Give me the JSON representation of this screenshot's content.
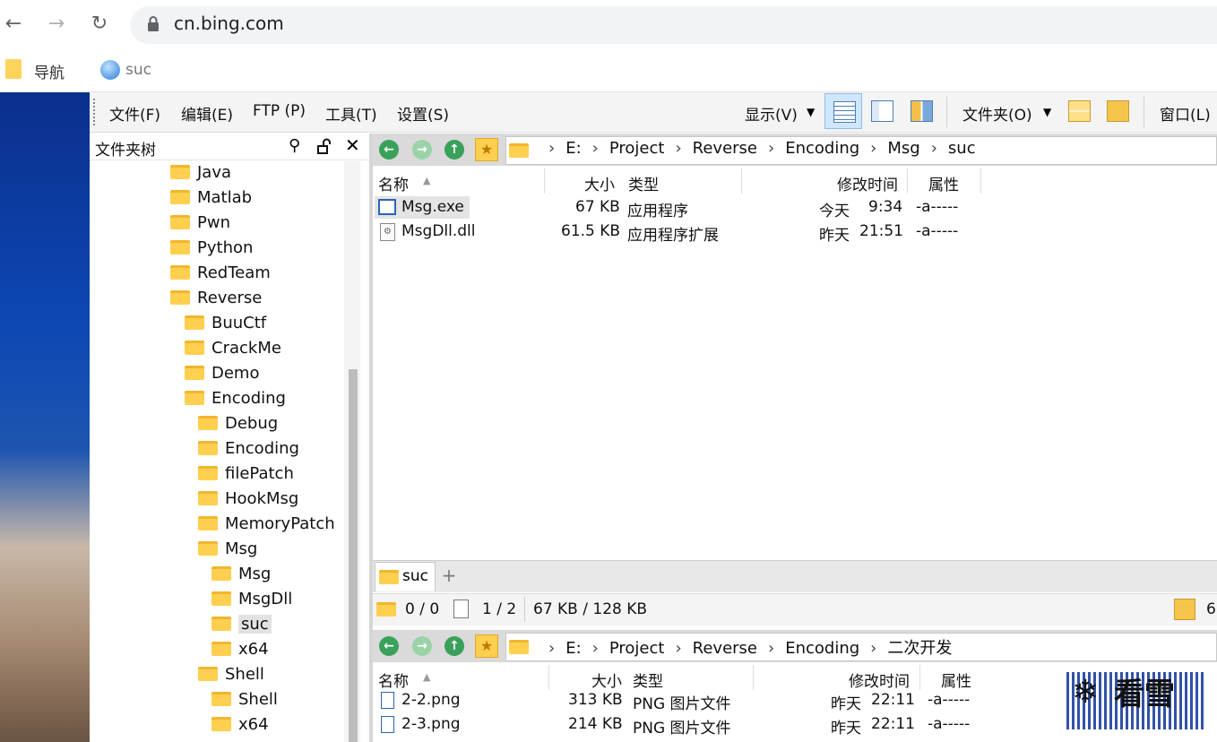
{
  "browser": {
    "url": "cn.bing.com",
    "bookmark_label": "导航",
    "back": "←",
    "forward": "→",
    "reload": "↻"
  },
  "app": {
    "title": "suc",
    "menu": [
      "文件(F)",
      "编辑(E)",
      "FTP (P)",
      "工具(T)",
      "设置(S)"
    ],
    "display_menu": "显示(V)",
    "folder_menu": "文件夹(O)",
    "window_menu": "窗口(L)"
  },
  "tree": {
    "title": "文件夹树",
    "items": [
      {
        "label": "Java",
        "depth": 1
      },
      {
        "label": "Matlab",
        "depth": 1
      },
      {
        "label": "Pwn",
        "depth": 1
      },
      {
        "label": "Python",
        "depth": 1
      },
      {
        "label": "RedTeam",
        "depth": 1
      },
      {
        "label": "Reverse",
        "depth": 1
      },
      {
        "label": "BuuCtf",
        "depth": 2
      },
      {
        "label": "CrackMe",
        "depth": 2
      },
      {
        "label": "Demo",
        "depth": 2
      },
      {
        "label": "Encoding",
        "depth": 2
      },
      {
        "label": "Debug",
        "depth": 3
      },
      {
        "label": "Encoding",
        "depth": 3
      },
      {
        "label": "filePatch",
        "depth": 3
      },
      {
        "label": "HookMsg",
        "depth": 3
      },
      {
        "label": "MemoryPatch",
        "depth": 3
      },
      {
        "label": "Msg",
        "depth": 3
      },
      {
        "label": "Msg",
        "depth": 4
      },
      {
        "label": "MsgDll",
        "depth": 4
      },
      {
        "label": "suc",
        "depth": 4,
        "selected": true
      },
      {
        "label": "x64",
        "depth": 4
      },
      {
        "label": "Shell",
        "depth": 3
      },
      {
        "label": "Shell",
        "depth": 4
      },
      {
        "label": "x64",
        "depth": 4
      }
    ]
  },
  "pane1": {
    "path": [
      "E:",
      "Project",
      "Reverse",
      "Encoding",
      "Msg",
      "suc"
    ],
    "columns": {
      "name": "名称",
      "size": "大小",
      "type": "类型",
      "modified": "修改时间",
      "attr": "属性"
    },
    "files": [
      {
        "name": "Msg.exe",
        "size": "67 KB",
        "type": "应用程序",
        "day": "今天",
        "time": "9:34",
        "attr": "-a-----",
        "icon": "exe-icon"
      },
      {
        "name": "MsgDll.dll",
        "size": "61.5 KB",
        "type": "应用程序扩展",
        "day": "昨天",
        "time": "21:51",
        "attr": "-a-----",
        "icon": "dll-icon"
      }
    ],
    "tab": "suc",
    "tab_add": "+",
    "status_folders": "0 / 0",
    "status_files": "1 / 2",
    "status_size": "67 KB / 128 KB",
    "status_right": "6"
  },
  "pane2": {
    "path": [
      "E:",
      "Project",
      "Reverse",
      "Encoding",
      "二次开发"
    ],
    "columns": {
      "name": "名称",
      "size": "大小",
      "type": "类型",
      "modified": "修改时间",
      "attr": "属性"
    },
    "files": [
      {
        "name": "2-2.png",
        "size": "313 KB",
        "type": "PNG 图片文件",
        "day": "昨天",
        "time": "22:11",
        "attr": "-a-----"
      },
      {
        "name": "2-3.png",
        "size": "214 KB",
        "type": "PNG 图片文件",
        "day": "昨天",
        "time": "22:11",
        "attr": "-a-----"
      }
    ]
  },
  "watermark": "看雪"
}
